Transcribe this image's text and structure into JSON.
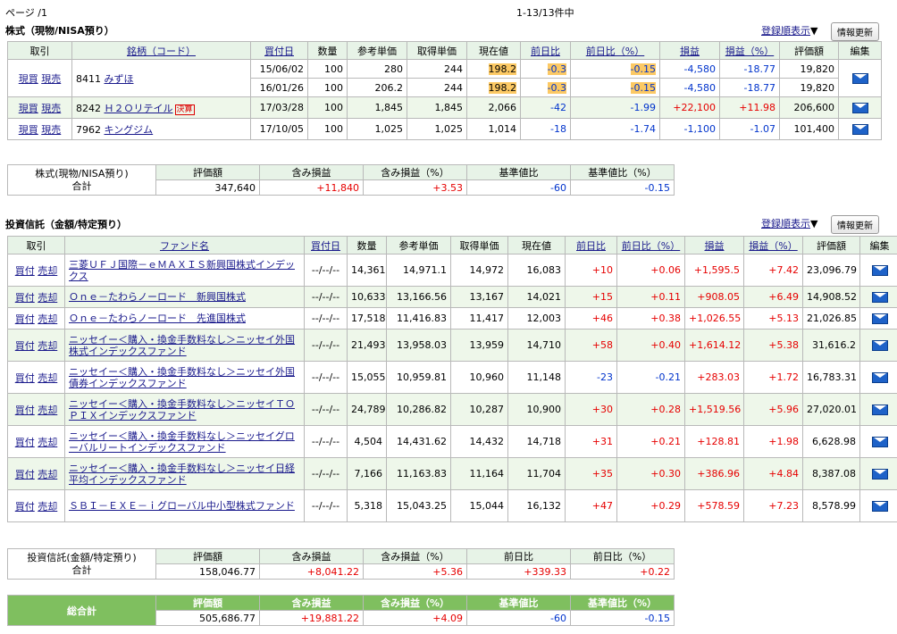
{
  "page_label": "ページ /1",
  "count_label": "1-13/13件中",
  "stocks": {
    "title": "株式（現物/NISA預り）",
    "sort_label": "登録順表示",
    "refresh_label": "情報更新",
    "headers": [
      "取引",
      "銘柄（コード）",
      "買付日",
      "数量",
      "参考単価",
      "取得単価",
      "現在値",
      "前日比",
      "前日比（%）",
      "損益",
      "損益（%）",
      "評価額",
      "編集"
    ],
    "rows": [
      {
        "buy": "現買",
        "sell": "現売",
        "code": "8411",
        "name": "みずほ",
        "badge": "",
        "lots": [
          {
            "date": "15/06/02",
            "qty": "100",
            "ref": "280",
            "cost": "244",
            "price": "198.2",
            "chg": "-0.3",
            "chgp": "-0.15",
            "pl": "-4,580",
            "plp": "-18.77",
            "val": "19,820"
          },
          {
            "date": "16/01/26",
            "qty": "100",
            "ref": "206.2",
            "cost": "244",
            "price": "198.2",
            "chg": "-0.3",
            "chgp": "-0.15",
            "pl": "-4,580",
            "plp": "-18.77",
            "val": "19,820"
          }
        ]
      },
      {
        "buy": "現買",
        "sell": "現売",
        "code": "8242",
        "name": "Ｈ２Ｏリテイル",
        "badge": "決算",
        "lots": [
          {
            "date": "17/03/28",
            "qty": "100",
            "ref": "1,845",
            "cost": "1,845",
            "price": "2,066",
            "chg": "-42",
            "chgp": "-1.99",
            "pl": "+22,100",
            "plp": "+11.98",
            "val": "206,600"
          }
        ]
      },
      {
        "buy": "現買",
        "sell": "現売",
        "code": "7962",
        "name": "キングジム",
        "badge": "",
        "lots": [
          {
            "date": "17/10/05",
            "qty": "100",
            "ref": "1,025",
            "cost": "1,025",
            "price": "1,014",
            "chg": "-18",
            "chgp": "-1.74",
            "pl": "-1,100",
            "plp": "-1.07",
            "val": "101,400"
          }
        ]
      }
    ],
    "summary": {
      "label1": "株式(現物/NISA預り)",
      "label2": "合計",
      "headers": [
        "評価額",
        "含み損益",
        "含み損益（%）",
        "基準値比",
        "基準値比（%）"
      ],
      "values": [
        "347,640",
        "+11,840",
        "+3.53",
        "-60",
        "-0.15"
      ]
    }
  },
  "funds": {
    "title": "投資信託（金額/特定預り）",
    "sort_label": "登録順表示",
    "refresh_label": "情報更新",
    "headers": [
      "取引",
      "ファンド名",
      "買付日",
      "数量",
      "参考単価",
      "取得単価",
      "現在値",
      "前日比",
      "前日比（%）",
      "損益",
      "損益（%）",
      "評価額",
      "編集"
    ],
    "rows": [
      {
        "buy": "買付",
        "sell": "売却",
        "name": "三菱ＵＦＪ国際－ｅＭＡＸＩＳ新興国株式インデックス",
        "date": "--/--/--",
        "qty": "14,361",
        "ref": "14,971.1",
        "cost": "14,972",
        "price": "16,083",
        "chg": "+10",
        "chgp": "+0.06",
        "pl": "+1,595.5",
        "plp": "+7.42",
        "val": "23,096.79"
      },
      {
        "buy": "買付",
        "sell": "売却",
        "name": "Ｏｎｅ－たわらノーロード　新興国株式",
        "date": "--/--/--",
        "qty": "10,633",
        "ref": "13,166.56",
        "cost": "13,167",
        "price": "14,021",
        "chg": "+15",
        "chgp": "+0.11",
        "pl": "+908.05",
        "plp": "+6.49",
        "val": "14,908.52"
      },
      {
        "buy": "買付",
        "sell": "売却",
        "name": "Ｏｎｅ－たわらノーロード　先進国株式",
        "date": "--/--/--",
        "qty": "17,518",
        "ref": "11,416.83",
        "cost": "11,417",
        "price": "12,003",
        "chg": "+46",
        "chgp": "+0.38",
        "pl": "+1,026.55",
        "plp": "+5.13",
        "val": "21,026.85"
      },
      {
        "buy": "買付",
        "sell": "売却",
        "name": "ニッセイー＜購入・換金手数料なし＞ニッセイ外国株式インデックスファンド",
        "date": "--/--/--",
        "qty": "21,493",
        "ref": "13,958.03",
        "cost": "13,959",
        "price": "14,710",
        "chg": "+58",
        "chgp": "+0.40",
        "pl": "+1,614.12",
        "plp": "+5.38",
        "val": "31,616.2"
      },
      {
        "buy": "買付",
        "sell": "売却",
        "name": "ニッセイー＜購入・換金手数料なし＞ニッセイ外国債券インデックスファンド",
        "date": "--/--/--",
        "qty": "15,055",
        "ref": "10,959.81",
        "cost": "10,960",
        "price": "11,148",
        "chg": "-23",
        "chgp": "-0.21",
        "pl": "+283.03",
        "plp": "+1.72",
        "val": "16,783.31"
      },
      {
        "buy": "買付",
        "sell": "売却",
        "name": "ニッセイー＜購入・換金手数料なし＞ニッセイＴＯＰＩＸインデックスファンド",
        "date": "--/--/--",
        "qty": "24,789",
        "ref": "10,286.82",
        "cost": "10,287",
        "price": "10,900",
        "chg": "+30",
        "chgp": "+0.28",
        "pl": "+1,519.56",
        "plp": "+5.96",
        "val": "27,020.01"
      },
      {
        "buy": "買付",
        "sell": "売却",
        "name": "ニッセイー＜購入・換金手数料なし＞ニッセイグローバルリートインデックスファンド",
        "date": "--/--/--",
        "qty": "4,504",
        "ref": "14,431.62",
        "cost": "14,432",
        "price": "14,718",
        "chg": "+31",
        "chgp": "+0.21",
        "pl": "+128.81",
        "plp": "+1.98",
        "val": "6,628.98"
      },
      {
        "buy": "買付",
        "sell": "売却",
        "name": "ニッセイー＜購入・換金手数料なし＞ニッセイ日経平均インデックスファンド",
        "date": "--/--/--",
        "qty": "7,166",
        "ref": "11,163.83",
        "cost": "11,164",
        "price": "11,704",
        "chg": "+35",
        "chgp": "+0.30",
        "pl": "+386.96",
        "plp": "+4.84",
        "val": "8,387.08"
      },
      {
        "buy": "買付",
        "sell": "売却",
        "name": "ＳＢＩ－ＥＸＥ－ｉグローバル中小型株式ファンド",
        "date": "--/--/--",
        "qty": "5,318",
        "ref": "15,043.25",
        "cost": "15,044",
        "price": "16,132",
        "chg": "+47",
        "chgp": "+0.29",
        "pl": "+578.59",
        "plp": "+7.23",
        "val": "8,578.99"
      }
    ],
    "summary": {
      "label1": "投資信託(金額/特定預り)",
      "label2": "合計",
      "headers": [
        "評価額",
        "含み損益",
        "含み損益（%）",
        "前日比",
        "前日比（%）"
      ],
      "values": [
        "158,046.77",
        "+8,041.22",
        "+5.36",
        "+339.33",
        "+0.22"
      ]
    }
  },
  "grand": {
    "label": "総合計",
    "headers": [
      "評価額",
      "含み損益",
      "含み損益（%）",
      "基準値比",
      "基準値比（%）"
    ],
    "values": [
      "505,686.77",
      "+19,881.22",
      "+4.09",
      "-60",
      "-0.15"
    ]
  },
  "colors": {
    "header_bg": "#e7f3e7",
    "highlight": "#fcc964",
    "positive": "#e60000",
    "negative": "#0033cc",
    "total_head": "#7fbf5f"
  }
}
